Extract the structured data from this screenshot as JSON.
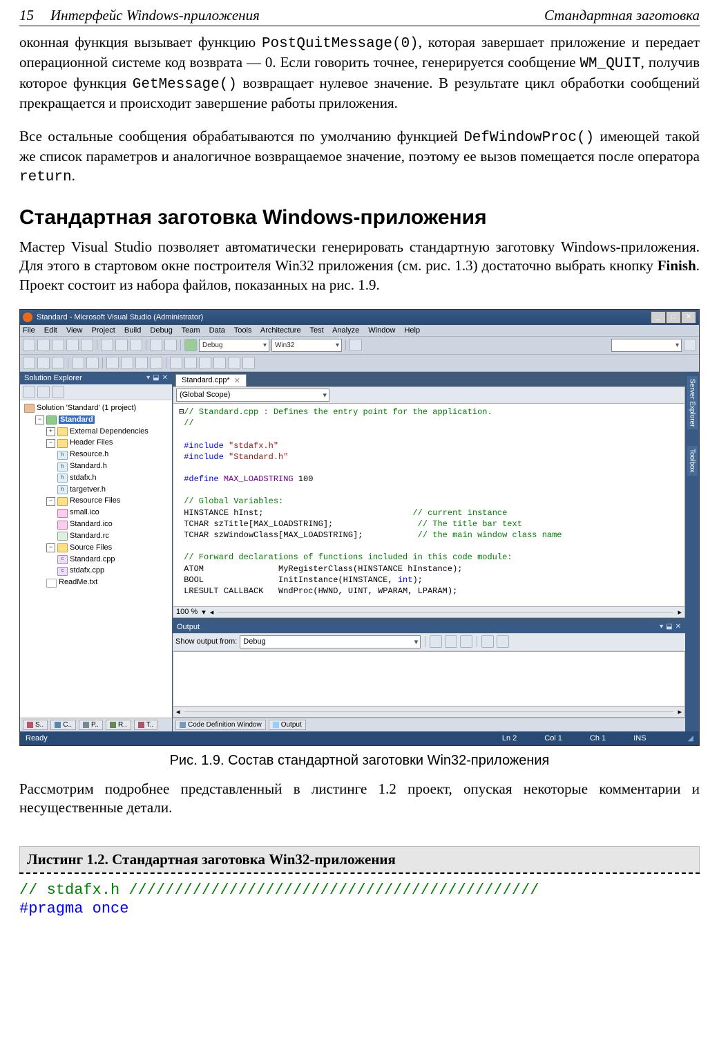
{
  "header": {
    "page_number": "15",
    "chapter": "Интерфейс Windows-приложения",
    "section": "Стандартная заготовка"
  },
  "para1_a": "оконная функция вызывает функцию ",
  "para1_code1": "PostQuitMessage(0)",
  "para1_b": ", которая завершает приложение и передает операционной системе код возврата — 0. Если говорить точнее, генерируется сообщение ",
  "para1_code2": "WM_QUIT",
  "para1_c": ", получив которое функция ",
  "para1_code3": "GetMessage()",
  "para1_d": " возвращает нулевое значение. В результате цикл обработки сообщений прекращается и происходит завершение работы приложения.",
  "para2_a": "Все остальные сообщения обрабатываются по умолчанию функцией ",
  "para2_code1": "DefWindowProc()",
  "para2_b": " имеющей такой же список параметров и аналогичное возвращаемое значение, поэтому ее вызов помещается после оператора ",
  "para2_code2": "return",
  "para2_c": ".",
  "h2": "Стандартная заготовка Windows-приложения",
  "para3_a": "Мастер Visual Studio позволяет автоматически генерировать стандартную заготовку Windows-приложения. Для этого в стартовом окне построителя Win32 приложения (см. рис. 1.3) достаточно выбрать кнопку ",
  "para3_bold": "Finish",
  "para3_b": ". Проект состоит из набора файлов, показанных на рис. 1.9.",
  "caption": "Рис. 1.9. Состав стандартной заготовки Win32-приложения",
  "para4": "Рассмотрим подробнее представленный в листинге 1.2 проект, опуская некоторые комментарии и несущественные детали.",
  "listing_title": "Листинг 1.2. Стандартная заготовка Win32-приложения",
  "listing_line1_a": "// stdafx.h ",
  "listing_line1_b": "/////////////////////////////////////////////",
  "listing_line2": "#pragma once",
  "ide": {
    "title": "Standard - Microsoft Visual Studio (Administrator)",
    "menu": [
      "File",
      "Edit",
      "View",
      "Project",
      "Build",
      "Debug",
      "Team",
      "Data",
      "Tools",
      "Architecture",
      "Test",
      "Analyze",
      "Window",
      "Help"
    ],
    "config": "Debug",
    "platform": "Win32",
    "solution_panel": {
      "title": "Solution Explorer",
      "pin": "▾ ₽ ✕"
    },
    "tree": {
      "root": "Solution 'Standard' (1 project)",
      "project": "Standard",
      "ext_deps": "External Dependencies",
      "header_files": "Header Files",
      "hdrs": [
        "Resource.h",
        "Standard.h",
        "stdafx.h",
        "targetver.h"
      ],
      "resource_files": "Resource Files",
      "res": [
        "small.ico",
        "Standard.ico",
        "Standard.rc"
      ],
      "source_files": "Source Files",
      "srcs": [
        "Standard.cpp",
        "stdafx.cpp"
      ],
      "readme": "ReadMe.txt"
    },
    "bottom_tabs": [
      "S..",
      "C..",
      "P..",
      "R..",
      "T.."
    ],
    "doc_tab": "Standard.cpp*",
    "scope": "(Global Scope)",
    "code": {
      "l1": "// Standard.cpp : Defines the entry point for the application.",
      "l2": "//",
      "l3": "#include ",
      "l3s": "\"stdafx.h\"",
      "l4": "#include ",
      "l4s": "\"Standard.h\"",
      "l5": "#define ",
      "l5m": "MAX_LOADSTRING",
      " l5v": " 100",
      "l6": "// Global Variables:",
      "l7": "HINSTANCE hInst;",
      "l7c": "// current instance",
      "l8": "TCHAR szTitle[MAX_LOADSTRING];",
      "l8c": "// The title bar text",
      "l9": "TCHAR szWindowClass[MAX_LOADSTRING];",
      "l9c": "// the main window class name",
      "l10": "// Forward declarations of functions included in this code module:",
      "l11": "ATOM               MyRegisterClass(HINSTANCE hInstance);",
      "l12": "BOOL               InitInstance(HINSTANCE, ",
      "l12k": "int",
      "l12b": ");",
      "l13": "LRESULT CALLBACK   WndProc(HWND, UINT, WPARAM, LPARAM);"
    },
    "zoom": "100 %",
    "output": {
      "title": "Output",
      "from_label": "Show output from:",
      "from_value": "Debug"
    },
    "bottom_tabs2": {
      "cdw": "Code Definition Window",
      "out": "Output"
    },
    "right_tabs": [
      "Server Explorer",
      "Toolbox"
    ],
    "status": {
      "ready": "Ready",
      "ln": "Ln 2",
      "col": "Col 1",
      "ch": "Ch 1",
      "ins": "INS"
    }
  }
}
